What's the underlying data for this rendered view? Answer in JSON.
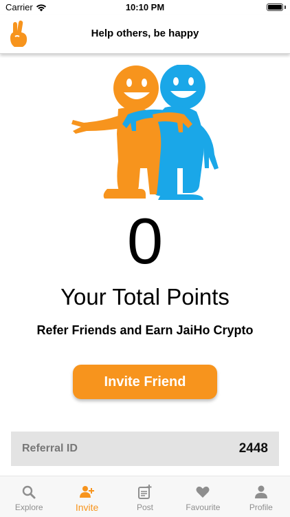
{
  "status": {
    "carrier": "Carrier",
    "time": "10:10 PM"
  },
  "header": {
    "title": "Help others, be happy"
  },
  "main": {
    "points": "0",
    "points_label": "Your Total Points",
    "subtitle": "Refer Friends and Earn JaiHo Crypto",
    "invite_button": "Invite Friend"
  },
  "referral": {
    "label": "Referral ID",
    "value": "2448"
  },
  "tabs": [
    {
      "label": "Explore",
      "icon": "search-icon",
      "active": false
    },
    {
      "label": "Invite",
      "icon": "add-user-icon",
      "active": true
    },
    {
      "label": "Post",
      "icon": "post-icon",
      "active": false
    },
    {
      "label": "Favourite",
      "icon": "heart-icon",
      "active": false
    },
    {
      "label": "Profile",
      "icon": "person-icon",
      "active": false
    }
  ],
  "colors": {
    "accent": "#f7941d",
    "friend_blue": "#1aa7e8",
    "inactive": "#8e8e8e"
  }
}
